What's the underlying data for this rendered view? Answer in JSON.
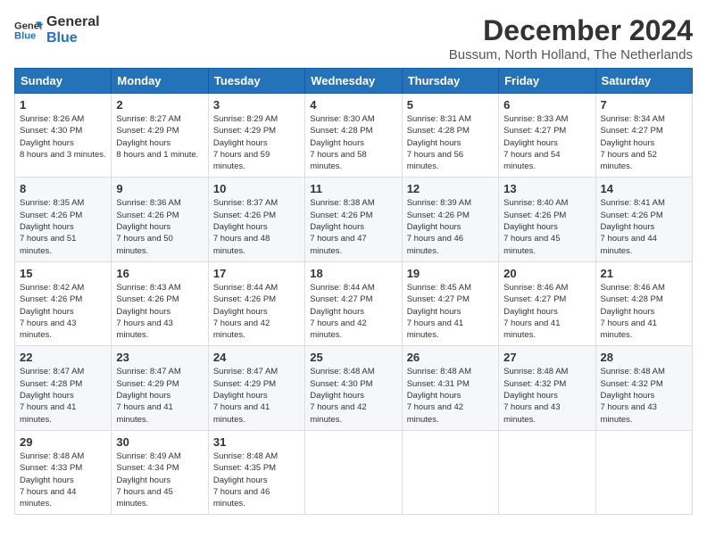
{
  "logo": {
    "line1": "General",
    "line2": "Blue"
  },
  "title": "December 2024",
  "subtitle": "Bussum, North Holland, The Netherlands",
  "weekdays": [
    "Sunday",
    "Monday",
    "Tuesday",
    "Wednesday",
    "Thursday",
    "Friday",
    "Saturday"
  ],
  "weeks": [
    [
      {
        "day": "1",
        "sunrise": "8:26 AM",
        "sunset": "4:30 PM",
        "daylight": "8 hours and 3 minutes."
      },
      {
        "day": "2",
        "sunrise": "8:27 AM",
        "sunset": "4:29 PM",
        "daylight": "8 hours and 1 minute."
      },
      {
        "day": "3",
        "sunrise": "8:29 AM",
        "sunset": "4:29 PM",
        "daylight": "7 hours and 59 minutes."
      },
      {
        "day": "4",
        "sunrise": "8:30 AM",
        "sunset": "4:28 PM",
        "daylight": "7 hours and 58 minutes."
      },
      {
        "day": "5",
        "sunrise": "8:31 AM",
        "sunset": "4:28 PM",
        "daylight": "7 hours and 56 minutes."
      },
      {
        "day": "6",
        "sunrise": "8:33 AM",
        "sunset": "4:27 PM",
        "daylight": "7 hours and 54 minutes."
      },
      {
        "day": "7",
        "sunrise": "8:34 AM",
        "sunset": "4:27 PM",
        "daylight": "7 hours and 52 minutes."
      }
    ],
    [
      {
        "day": "8",
        "sunrise": "8:35 AM",
        "sunset": "4:26 PM",
        "daylight": "7 hours and 51 minutes."
      },
      {
        "day": "9",
        "sunrise": "8:36 AM",
        "sunset": "4:26 PM",
        "daylight": "7 hours and 50 minutes."
      },
      {
        "day": "10",
        "sunrise": "8:37 AM",
        "sunset": "4:26 PM",
        "daylight": "7 hours and 48 minutes."
      },
      {
        "day": "11",
        "sunrise": "8:38 AM",
        "sunset": "4:26 PM",
        "daylight": "7 hours and 47 minutes."
      },
      {
        "day": "12",
        "sunrise": "8:39 AM",
        "sunset": "4:26 PM",
        "daylight": "7 hours and 46 minutes."
      },
      {
        "day": "13",
        "sunrise": "8:40 AM",
        "sunset": "4:26 PM",
        "daylight": "7 hours and 45 minutes."
      },
      {
        "day": "14",
        "sunrise": "8:41 AM",
        "sunset": "4:26 PM",
        "daylight": "7 hours and 44 minutes."
      }
    ],
    [
      {
        "day": "15",
        "sunrise": "8:42 AM",
        "sunset": "4:26 PM",
        "daylight": "7 hours and 43 minutes."
      },
      {
        "day": "16",
        "sunrise": "8:43 AM",
        "sunset": "4:26 PM",
        "daylight": "7 hours and 43 minutes."
      },
      {
        "day": "17",
        "sunrise": "8:44 AM",
        "sunset": "4:26 PM",
        "daylight": "7 hours and 42 minutes."
      },
      {
        "day": "18",
        "sunrise": "8:44 AM",
        "sunset": "4:27 PM",
        "daylight": "7 hours and 42 minutes."
      },
      {
        "day": "19",
        "sunrise": "8:45 AM",
        "sunset": "4:27 PM",
        "daylight": "7 hours and 41 minutes."
      },
      {
        "day": "20",
        "sunrise": "8:46 AM",
        "sunset": "4:27 PM",
        "daylight": "7 hours and 41 minutes."
      },
      {
        "day": "21",
        "sunrise": "8:46 AM",
        "sunset": "4:28 PM",
        "daylight": "7 hours and 41 minutes."
      }
    ],
    [
      {
        "day": "22",
        "sunrise": "8:47 AM",
        "sunset": "4:28 PM",
        "daylight": "7 hours and 41 minutes."
      },
      {
        "day": "23",
        "sunrise": "8:47 AM",
        "sunset": "4:29 PM",
        "daylight": "7 hours and 41 minutes."
      },
      {
        "day": "24",
        "sunrise": "8:47 AM",
        "sunset": "4:29 PM",
        "daylight": "7 hours and 41 minutes."
      },
      {
        "day": "25",
        "sunrise": "8:48 AM",
        "sunset": "4:30 PM",
        "daylight": "7 hours and 42 minutes."
      },
      {
        "day": "26",
        "sunrise": "8:48 AM",
        "sunset": "4:31 PM",
        "daylight": "7 hours and 42 minutes."
      },
      {
        "day": "27",
        "sunrise": "8:48 AM",
        "sunset": "4:32 PM",
        "daylight": "7 hours and 43 minutes."
      },
      {
        "day": "28",
        "sunrise": "8:48 AM",
        "sunset": "4:32 PM",
        "daylight": "7 hours and 43 minutes."
      }
    ],
    [
      {
        "day": "29",
        "sunrise": "8:48 AM",
        "sunset": "4:33 PM",
        "daylight": "7 hours and 44 minutes."
      },
      {
        "day": "30",
        "sunrise": "8:49 AM",
        "sunset": "4:34 PM",
        "daylight": "7 hours and 45 minutes."
      },
      {
        "day": "31",
        "sunrise": "8:48 AM",
        "sunset": "4:35 PM",
        "daylight": "7 hours and 46 minutes."
      },
      null,
      null,
      null,
      null
    ]
  ],
  "labels": {
    "sunrise": "Sunrise:",
    "sunset": "Sunset:",
    "daylight": "Daylight hours"
  }
}
